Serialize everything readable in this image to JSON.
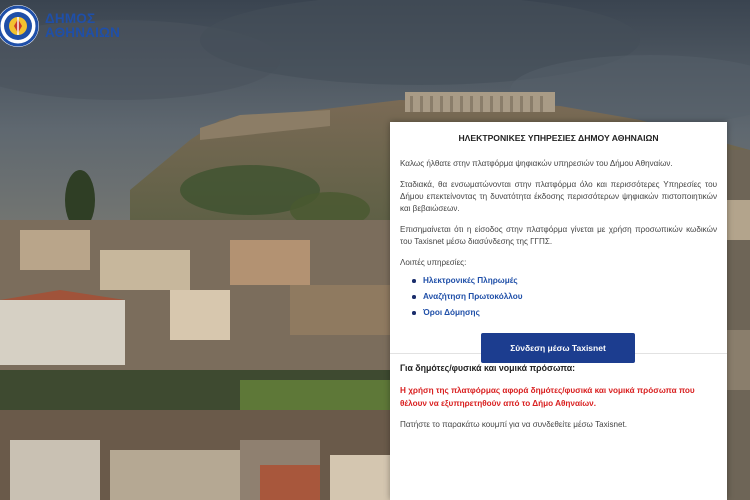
{
  "logo": {
    "line1": "ΔΗΜΟΣ",
    "line2": "ΑΘΗΝΑΙΩΝ"
  },
  "panel": {
    "title": "ΗΛΕΚΤΡΟΝΙΚΕΣ ΥΠΗΡΕΣΙΕΣ ΔΗΜΟΥ ΑΘΗΝΑΙΩΝ",
    "welcome": "Καλως ήλθατε στην πλατφόρμα ψηφιακών υπηρεσιών του Δήμου Αθηναίων.",
    "gradually": "Σταδιακά, θα ενσωματώνονται στην πλατφόρμα όλο και περισσότερες Υπηρεσίες του Δήμου επεκτείνοντας τη δυνατότητα έκδοσης περισσότερων ψηφιακών πιστοποιητικών και βεβαιώσεων.",
    "login_note": "Επισημαίνεται ότι η είσοδος στην πλατφόρμα γίνεται με χρήση προσωπικών κωδικών του Taxisnet μέσω διασύνδεσης της ΓΓΠΣ.",
    "other_services_label": "Λοιπές υπηρεσίες:",
    "services": [
      "Ηλεκτρονικές Πληρωμές",
      "Αναζήτηση Πρωτοκόλλου",
      "Όροι Δόμησης"
    ],
    "section_title": "Για δημότες/φυσικά και νομικά πρόσωπα:",
    "red_note": "Η χρήση της πλατφόρμας αφορά δημότες/φυσικά και νομικά πρόσωπα που θέλουν να εξυπηρετηθούν από το Δήμο Αθηναίων.",
    "hint": "Πατήστε το παρακάτω κουμπί για να συνδεθείτε μέσω Taxisnet.",
    "login_button": "Σύνδεση μέσω Taxisnet"
  },
  "colors": {
    "brand_blue": "#1f4fa8",
    "button_blue": "#1c3d8f",
    "warning_red": "#d92020"
  }
}
